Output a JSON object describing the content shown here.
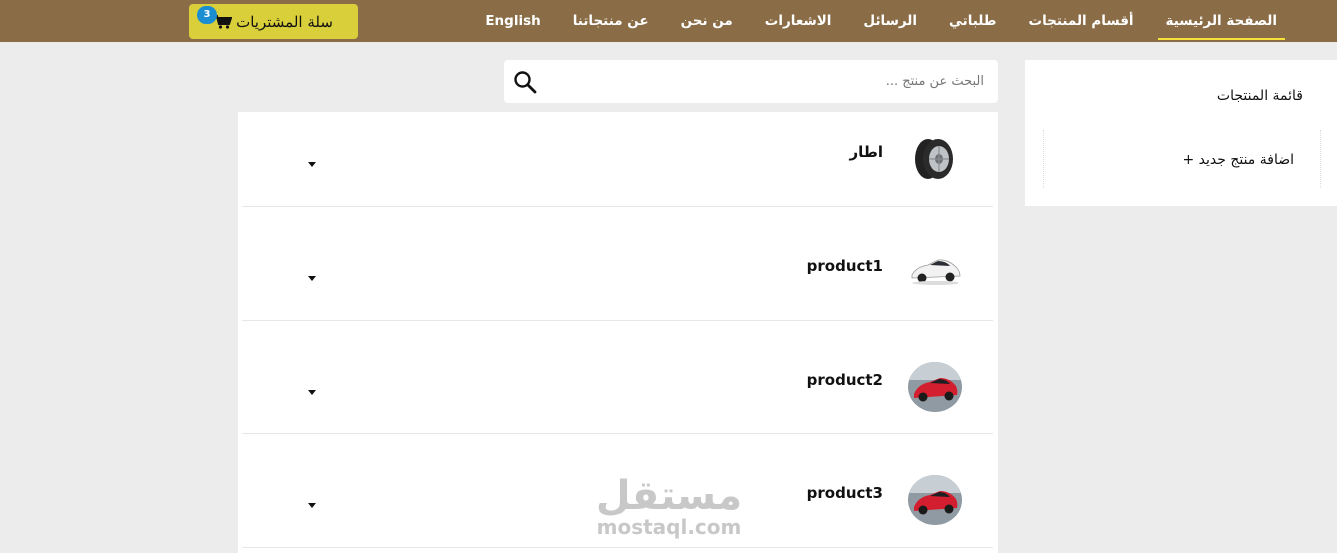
{
  "nav": {
    "items": [
      {
        "label": "الصفحة الرئيسية",
        "active": true
      },
      {
        "label": "أقسام المنتجات",
        "active": false
      },
      {
        "label": "طلباتي",
        "active": false
      },
      {
        "label": "الرسائل",
        "active": false
      },
      {
        "label": "الاشعارات",
        "active": false
      },
      {
        "label": "من نحن",
        "active": false
      },
      {
        "label": "عن منتجاتنا",
        "active": false
      },
      {
        "label": "English",
        "active": false
      }
    ],
    "cart": {
      "label": "سلة المشتريات",
      "count": "3",
      "icon": "shopping-cart-icon"
    },
    "colors": {
      "bar": "#8a6d47",
      "cart_button": "#d9cf3a",
      "badge": "#1b8ed1",
      "active_underline": "#f4e23a"
    }
  },
  "sidebar": {
    "title": "قائمة المنتجات",
    "add_label": "+ اضافة منتج جديد"
  },
  "search": {
    "placeholder": "البحث عن منتج ...",
    "value": "",
    "icon": "search-icon"
  },
  "products": [
    {
      "name": "اطار",
      "thumb": "tire"
    },
    {
      "name": "product1",
      "thumb": "white-car"
    },
    {
      "name": "product2",
      "thumb": "red-car"
    },
    {
      "name": "product3",
      "thumb": "red-car"
    }
  ],
  "watermark": {
    "arabic": "مستقل",
    "latin": "mostaql.com"
  }
}
